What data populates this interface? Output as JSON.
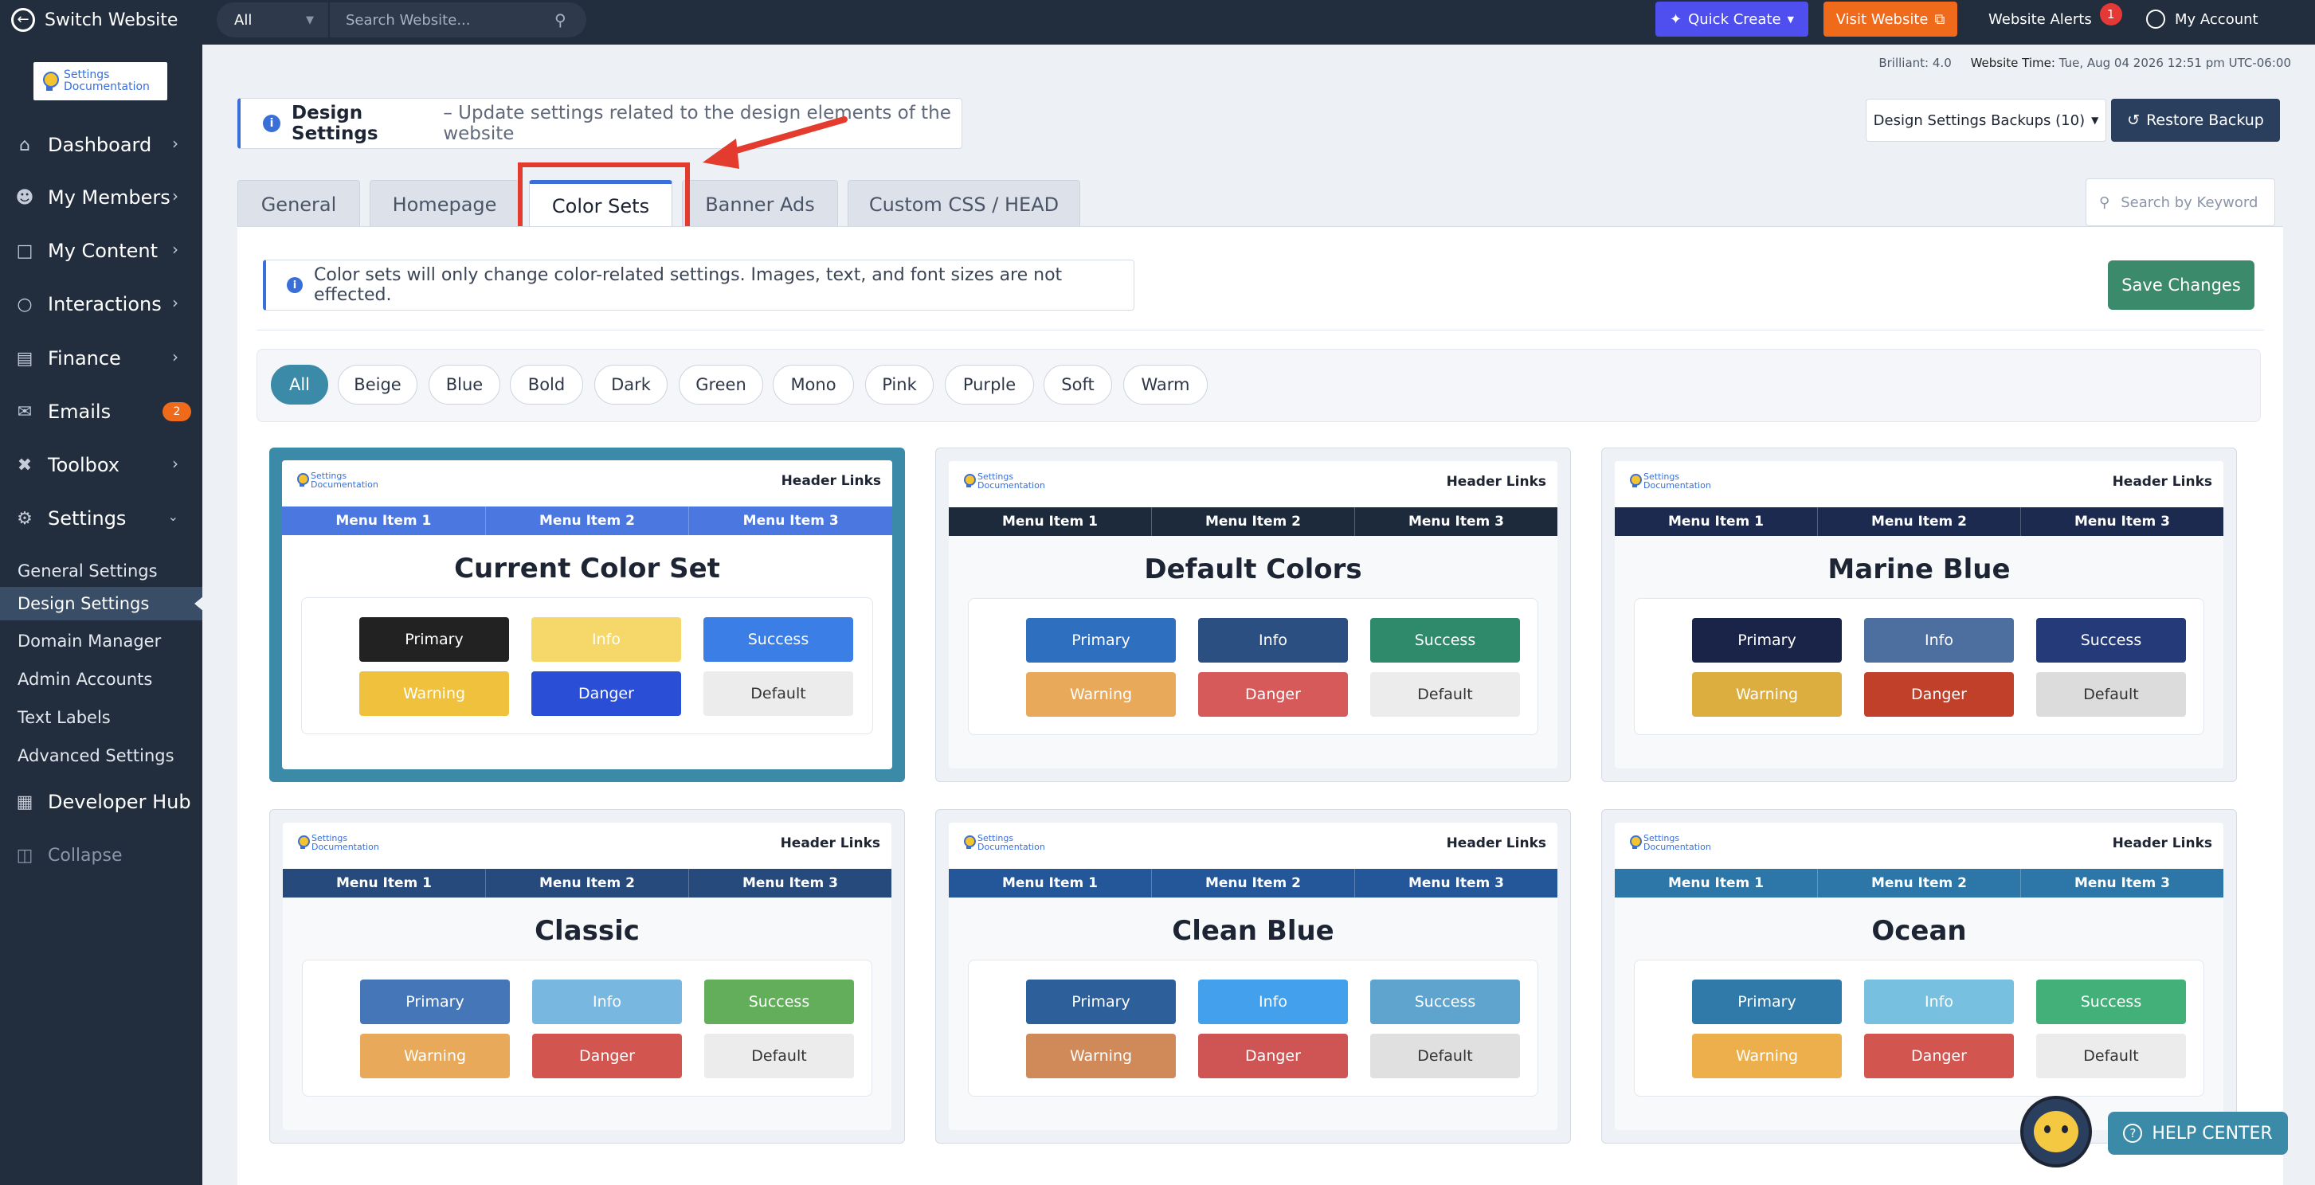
{
  "topbar": {
    "switch_label": "Switch Website",
    "scope_value": "All",
    "search_placeholder": "Search Website...",
    "quick_create": "Quick Create",
    "visit_website": "Visit Website",
    "alerts_label": "Website Alerts",
    "alerts_count": "1",
    "account_label": "My Account",
    "colors": {
      "quick_create": "#4f4ff0",
      "visit_website": "#f06a1c"
    }
  },
  "logo": {
    "line1": "Settings",
    "line2": "Documentation"
  },
  "sidebar": {
    "items": [
      {
        "label": "Dashboard",
        "icon": "home-icon"
      },
      {
        "label": "My Members",
        "icon": "members-icon"
      },
      {
        "label": "My Content",
        "icon": "folder-icon"
      },
      {
        "label": "Interactions",
        "icon": "chat-icon"
      },
      {
        "label": "Finance",
        "icon": "bar-chart-icon"
      },
      {
        "label": "Emails",
        "icon": "mail-icon",
        "badge": "2"
      },
      {
        "label": "Toolbox",
        "icon": "tools-icon"
      },
      {
        "label": "Settings",
        "icon": "gear-icon"
      }
    ],
    "settings_sub": [
      "General Settings",
      "Design Settings",
      "Domain Manager",
      "Admin Accounts",
      "Text Labels",
      "Advanced Settings"
    ],
    "active_sub": "Design Settings",
    "developer_hub": "Developer Hub",
    "collapse": "Collapse"
  },
  "meta": {
    "version_label": "Brilliant:",
    "version": "4.0",
    "time_label": "Website Time:",
    "time": "Tue, Aug 04 2026 12:51 pm UTC-06:00"
  },
  "page": {
    "title": "Design Settings",
    "description": "– Update settings related to the design elements of the website",
    "backups_label": "Design Settings Backups (10)",
    "restore_label": "Restore Backup"
  },
  "tabs": [
    "General",
    "Homepage",
    "Color Sets",
    "Banner Ads",
    "Custom CSS / HEAD"
  ],
  "active_tab": "Color Sets",
  "keyword_search_placeholder": "Search by Keyword",
  "notice": "Color sets will only change color-related settings. Images, text, and font sizes are not effected.",
  "save_label": "Save Changes",
  "filters": [
    "All",
    "Beige",
    "Blue",
    "Bold",
    "Dark",
    "Green",
    "Mono",
    "Pink",
    "Purple",
    "Soft",
    "Warm"
  ],
  "active_filter": "All",
  "preview": {
    "header_links": "Header Links",
    "menu_items": [
      "Menu Item 1",
      "Menu Item 2",
      "Menu Item 3"
    ],
    "button_labels": [
      "Primary",
      "Info",
      "Success",
      "Warning",
      "Danger",
      "Default"
    ]
  },
  "color_sets": [
    {
      "name": "Current Color Set",
      "selected": true,
      "menu": "#4a78e0",
      "buttons": [
        {
          "bg": "#222222",
          "fg": "#ffffff"
        },
        {
          "bg": "#f5d76a",
          "fg": "#ffffff"
        },
        {
          "bg": "#3a7ee6",
          "fg": "#ffffff"
        },
        {
          "bg": "#f0c13c",
          "fg": "#ffffff"
        },
        {
          "bg": "#2a4fd6",
          "fg": "#ffffff"
        },
        {
          "bg": "#ececec",
          "fg": "#333333"
        }
      ]
    },
    {
      "name": "Default Colors",
      "selected": false,
      "menu": "#1d2a3c",
      "buttons": [
        {
          "bg": "#2f6fbf",
          "fg": "#ffffff"
        },
        {
          "bg": "#2c4f82",
          "fg": "#ffffff"
        },
        {
          "bg": "#2e8a6a",
          "fg": "#ffffff"
        },
        {
          "bg": "#e8aa5a",
          "fg": "#ffffff"
        },
        {
          "bg": "#d65a5a",
          "fg": "#ffffff"
        },
        {
          "bg": "#ececec",
          "fg": "#333333"
        }
      ]
    },
    {
      "name": "Marine Blue",
      "selected": false,
      "menu": "#1d2a50",
      "buttons": [
        {
          "bg": "#1a2448",
          "fg": "#ffffff"
        },
        {
          "bg": "#4d6fa0",
          "fg": "#ffffff"
        },
        {
          "bg": "#253a78",
          "fg": "#ffffff"
        },
        {
          "bg": "#dcae40",
          "fg": "#ffffff"
        },
        {
          "bg": "#c0402a",
          "fg": "#ffffff"
        },
        {
          "bg": "#dcdcdc",
          "fg": "#333333"
        }
      ]
    },
    {
      "name": "Classic",
      "selected": false,
      "menu": "#264a7c",
      "buttons": [
        {
          "bg": "#4476b8",
          "fg": "#ffffff"
        },
        {
          "bg": "#78b8e0",
          "fg": "#ffffff"
        },
        {
          "bg": "#62ae5a",
          "fg": "#ffffff"
        },
        {
          "bg": "#e8aa5a",
          "fg": "#ffffff"
        },
        {
          "bg": "#d25550",
          "fg": "#ffffff"
        },
        {
          "bg": "#ececec",
          "fg": "#333333"
        }
      ]
    },
    {
      "name": "Clean Blue",
      "selected": false,
      "menu": "#23579a",
      "buttons": [
        {
          "bg": "#2d5f9a",
          "fg": "#ffffff"
        },
        {
          "bg": "#42a0ec",
          "fg": "#ffffff"
        },
        {
          "bg": "#5ea4cf",
          "fg": "#ffffff"
        },
        {
          "bg": "#d08a5a",
          "fg": "#ffffff"
        },
        {
          "bg": "#cf5555",
          "fg": "#ffffff"
        },
        {
          "bg": "#e0e0e0",
          "fg": "#333333"
        }
      ]
    },
    {
      "name": "Ocean",
      "selected": false,
      "menu": "#2c76a8",
      "buttons": [
        {
          "bg": "#2f7aa8",
          "fg": "#ffffff"
        },
        {
          "bg": "#78c0e0",
          "fg": "#ffffff"
        },
        {
          "bg": "#42b078",
          "fg": "#ffffff"
        },
        {
          "bg": "#ecaf4c",
          "fg": "#ffffff"
        },
        {
          "bg": "#d25550",
          "fg": "#ffffff"
        },
        {
          "bg": "#ececec",
          "fg": "#333333"
        }
      ]
    }
  ],
  "help_label": "HELP CENTER",
  "annotation_color": "#e33b2e"
}
